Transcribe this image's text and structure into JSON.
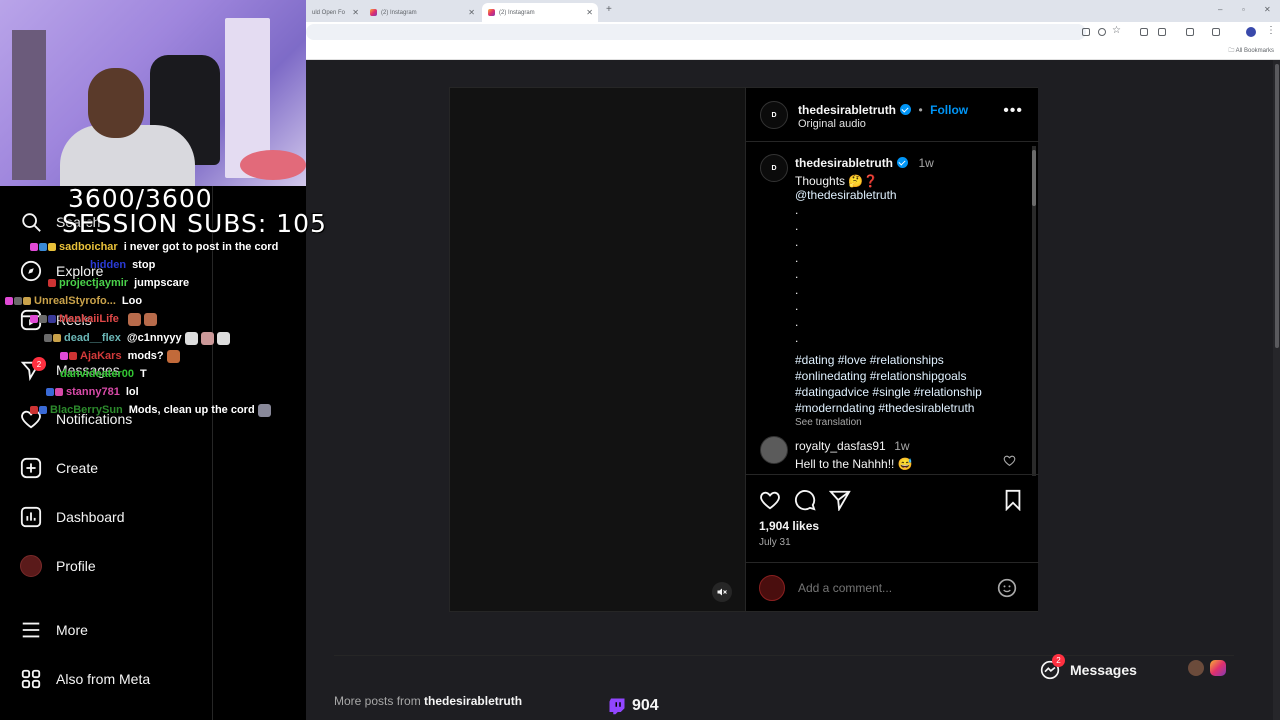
{
  "browser": {
    "tabs": [
      {
        "title": "uld Open Fo"
      },
      {
        "title": "(2) Instagram"
      },
      {
        "title": "(2) Instagram"
      }
    ],
    "all_bookmarks": "All Bookmarks"
  },
  "stream": {
    "subs_line1": "3600/3600",
    "subs_line2": "SESSION SUBS: 105",
    "bits_count": "904"
  },
  "chat": [
    {
      "user": "sadboichar",
      "msg": "i never got to post in the cord",
      "color": "#e8c13a"
    },
    {
      "user": "hidden",
      "msg": "stop",
      "color": "#2a3bd6"
    },
    {
      "user": "projectjaymir",
      "msg": "jumpscare",
      "color": "#4ad14a"
    },
    {
      "user": "UnrealStyrofo...",
      "msg": "Loo",
      "color": "#c9a24a"
    },
    {
      "user": "MankaiiLife",
      "msg": "",
      "color": "#e04848"
    },
    {
      "user": "dead__flex",
      "msg": "@c1nnyyy",
      "color": "#6bb7b7"
    },
    {
      "user": "AjaKars",
      "msg": "mods?",
      "color": "#d23a3a"
    },
    {
      "user": "danvideater00",
      "msg": "T",
      "color": "#33c633"
    },
    {
      "user": "stanny781",
      "msg": "lol",
      "color": "#d84aa8"
    },
    {
      "user": "BlacBerrySun",
      "msg": "Mods, clean up the cord",
      "color": "#2c8a2c"
    }
  ],
  "sidebar": {
    "items": [
      {
        "label": "Search",
        "icon": "search-icon"
      },
      {
        "label": "Explore",
        "icon": "compass-icon"
      },
      {
        "label": "Reels",
        "icon": "reels-icon"
      },
      {
        "label": "Messages",
        "icon": "messenger-icon",
        "badge": "2"
      },
      {
        "label": "Notifications",
        "icon": "heart-icon"
      },
      {
        "label": "Create",
        "icon": "plus-square-icon"
      },
      {
        "label": "Dashboard",
        "icon": "dashboard-icon"
      },
      {
        "label": "Profile",
        "icon": "avatar"
      },
      {
        "label": "More",
        "icon": "menu-icon"
      },
      {
        "label": "Also from Meta",
        "icon": "meta-icon"
      }
    ]
  },
  "post": {
    "username": "thedesirabletruth",
    "follow": "Follow",
    "separator": "•",
    "audio": "Original audio",
    "caption": {
      "time": "1w",
      "text": "Thoughts 🤔❓",
      "mention": "@thedesirabletruth",
      "dots": [
        ".",
        ".",
        ".",
        ".",
        ".",
        ".",
        ".",
        ".",
        "."
      ],
      "hashtags_line1": "#dating #love #relationships",
      "hashtags_line2": "#onlinedating #relationshipgoals",
      "hashtags_line3": "#datingadvice #single #relationship",
      "hashtags_line4": "#moderndating #thedesirabletruth",
      "see_translation": "See translation"
    },
    "comment": {
      "user": "royalty_dasfas91",
      "time": "1w",
      "text": "Hell to the Nahhh!! 😅"
    },
    "likes": "1,904 likes",
    "date": "July 31",
    "add_comment_placeholder": "Add a comment..."
  },
  "footer": {
    "more_posts_prefix": "More posts from",
    "more_posts_user": "thedesirabletruth",
    "messages_label": "Messages",
    "messages_badge": "2"
  },
  "colors": {
    "accent": "#0095f6",
    "background": "#000000",
    "notification": "#ff3040"
  }
}
